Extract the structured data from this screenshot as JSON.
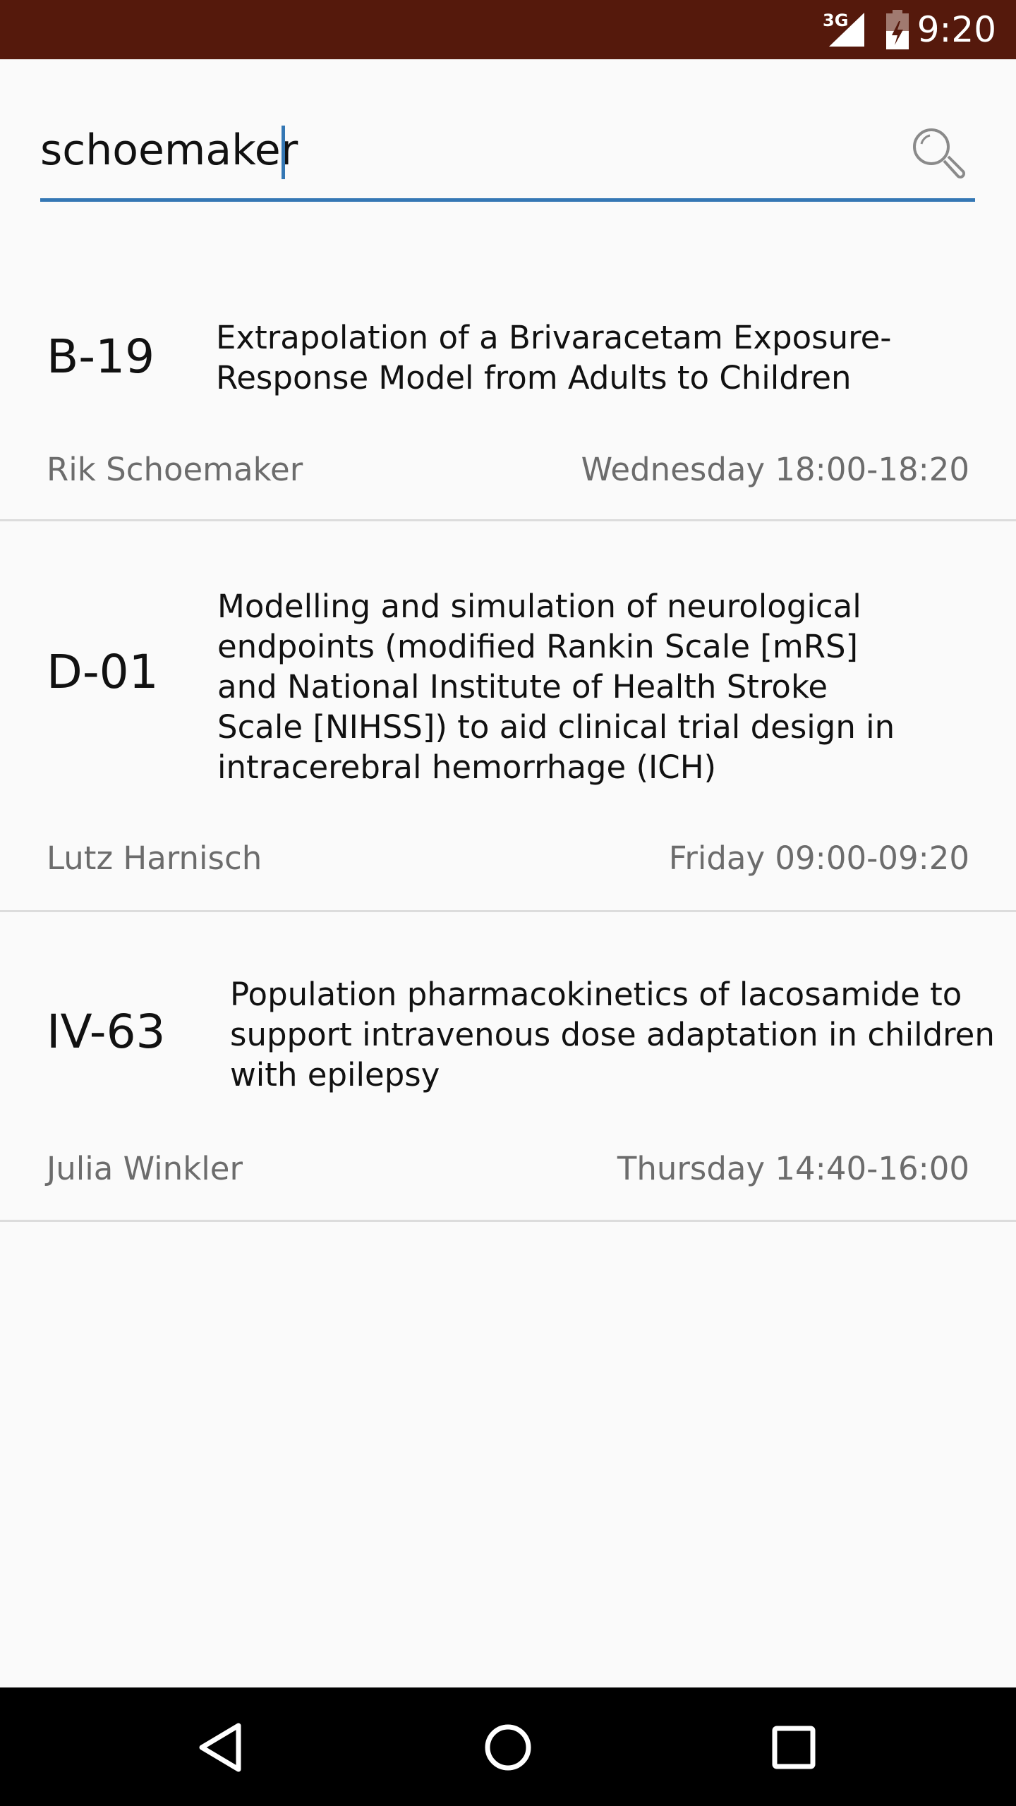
{
  "status_bar": {
    "network": "3G",
    "clock": "9:20",
    "icons": [
      "signal-icon",
      "battery-icon"
    ]
  },
  "search": {
    "value": "schoemaker",
    "icon": "search-icon",
    "accent_color": "#3477b4"
  },
  "results": [
    {
      "code": "B-19",
      "title_lines": [
        "Extrapolation of a Brivaracetam Exposure-",
        "Response Model from Adults to Children"
      ],
      "author": "Rik Schoemaker",
      "time": "Wednesday 18:00-18:20"
    },
    {
      "code": "D-01",
      "title_lines": [
        "Modelling and simulation of neurological",
        "endpoints (modified Rankin Scale [mRS]",
        "and National Institute of Health Stroke",
        "Scale [NIHSS]) to aid clinical trial design in",
        "intracerebral hemorrhage (ICH)"
      ],
      "author": "Lutz Harnisch",
      "time": "Friday 09:00-09:20"
    },
    {
      "code": "IV-63",
      "title_lines": [
        "Population pharmacokinetics of lacosamide to",
        "support intravenous dose adaptation in children",
        "with epilepsy"
      ],
      "author": "Julia Winkler",
      "time": "Thursday 14:40-16:00"
    }
  ],
  "nav_bar": {
    "icons": [
      "back-icon",
      "home-icon",
      "recents-icon"
    ]
  },
  "colors": {
    "status_bar": "#55190c",
    "background": "#fafafa",
    "secondary_text": "#6c6c6c",
    "divider": "#dcdcdc"
  }
}
